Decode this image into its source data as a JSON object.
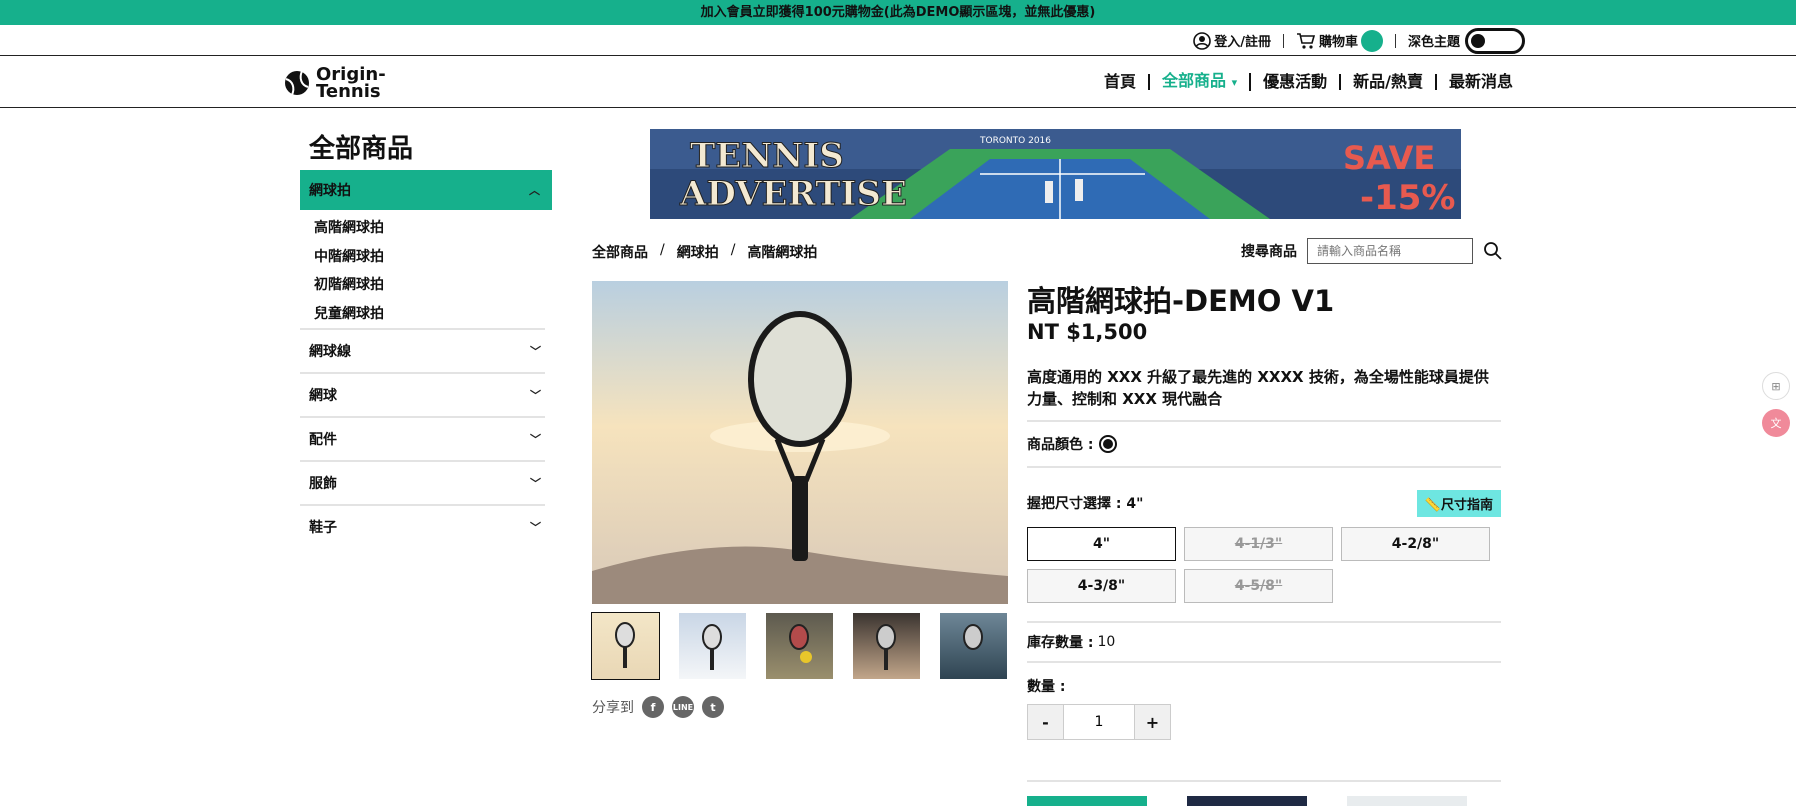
{
  "promo": {
    "text": "加入會員立即獲得100元購物金(此為DEMO顯示區塊，並無此優惠)"
  },
  "util": {
    "login": "登入/註冊",
    "cart": "購物車",
    "dark_theme": "深色主題"
  },
  "logo": {
    "line1": "Origin-",
    "line2": "Tennis"
  },
  "menu": {
    "items": [
      "首頁",
      "全部商品",
      "優惠活動",
      "新品/熱賣",
      "最新消息"
    ],
    "active_chevron": "⌄"
  },
  "sidebar": {
    "title": "全部商品",
    "open_category": "網球拍",
    "sub_items": [
      "高階網球拍",
      "中階網球拍",
      "初階網球拍",
      "兒童網球拍"
    ],
    "categories": [
      "網球線",
      "網球",
      "配件",
      "服飾",
      "鞋子"
    ]
  },
  "banner": {
    "left": "TENNIS\nADVERTISE",
    "right1": "SAVE",
    "right2": "-15%",
    "sign": "TORONTO 2016"
  },
  "breadcrumb": [
    "全部商品",
    "網球拍",
    "高階網球拍"
  ],
  "search": {
    "label": "搜尋商品",
    "placeholder": "請輸入商品名稱"
  },
  "share": {
    "label": "分享到",
    "icons": [
      "facebook-icon",
      "line-icon",
      "twitter-icon"
    ]
  },
  "product": {
    "title": "高階網球拍-DEMO V1",
    "price": "NT $1,500",
    "desc": "高度通用的 XXX 升級了最先進的 XXXX 技術，為全場性能球員提供力量、控制和 XXX 現代融合",
    "color_label": "商品顏色 :",
    "size_label": "握把尺寸選擇 : 4\"",
    "size_guide": "尺寸指南",
    "sizes": [
      "4\"",
      "4-1/3\"",
      "4-2/8\"",
      "4-3/8\"",
      "4-5/8\""
    ],
    "stock_label": "庫存數量 :",
    "stock_value": "10",
    "qty_label": "數量 :",
    "qty_value": "1",
    "minus": "-",
    "plus": "+"
  },
  "colors": {
    "accent": "#16b08c",
    "guide": "#6ee6e1",
    "dark": "#111111"
  }
}
